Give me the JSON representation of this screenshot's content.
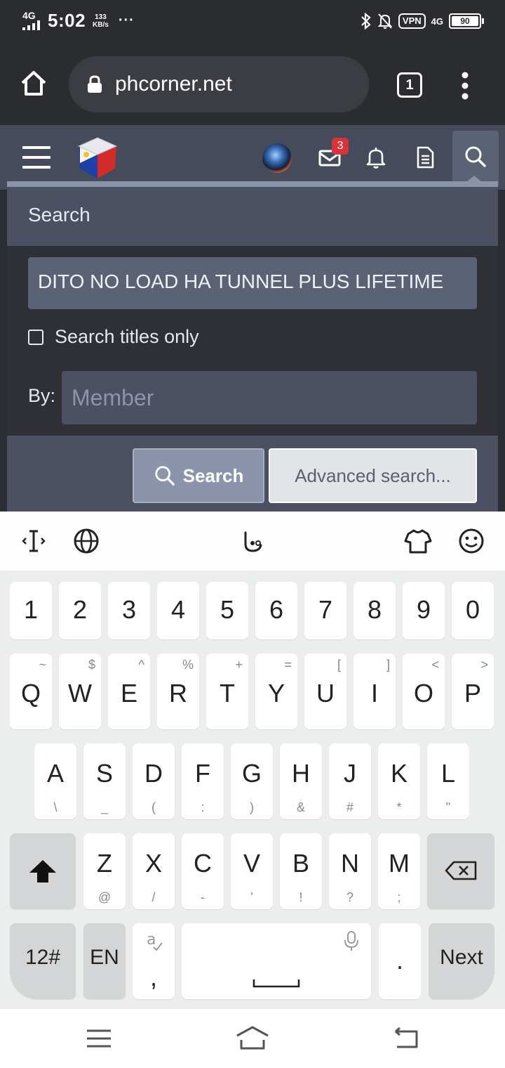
{
  "status_bar": {
    "network": "4G",
    "time": "5:02",
    "speed_value": "133",
    "speed_unit": "KB/s",
    "more": "···",
    "vpn": "VPN",
    "net_right": "4G",
    "battery": "90"
  },
  "browser": {
    "url": "phcorner.net",
    "tab_count": "1"
  },
  "site_header": {
    "inbox_badge": "3"
  },
  "search_panel": {
    "title": "Search",
    "query": "DITO NO LOAD HA TUNNEL PLUS LIFETIME",
    "titles_only_label": "Search titles only",
    "by_label": "By:",
    "member_placeholder": "Member",
    "search_button": "Search",
    "advanced_button": "Advanced search..."
  },
  "keyboard": {
    "number_row": [
      "1",
      "2",
      "3",
      "4",
      "5",
      "6",
      "7",
      "8",
      "9",
      "0"
    ],
    "row1": [
      {
        "k": "Q",
        "s": "~"
      },
      {
        "k": "W",
        "s": "$"
      },
      {
        "k": "E",
        "s": "^"
      },
      {
        "k": "R",
        "s": "%"
      },
      {
        "k": "T",
        "s": "+"
      },
      {
        "k": "Y",
        "s": "="
      },
      {
        "k": "U",
        "s": "["
      },
      {
        "k": "I",
        "s": "]"
      },
      {
        "k": "O",
        "s": "<"
      },
      {
        "k": "P",
        "s": ">"
      }
    ],
    "row2": [
      {
        "k": "A",
        "s": "\\"
      },
      {
        "k": "S",
        "s": "_"
      },
      {
        "k": "D",
        "s": "("
      },
      {
        "k": "F",
        "s": ":"
      },
      {
        "k": "G",
        "s": ")"
      },
      {
        "k": "H",
        "s": "&"
      },
      {
        "k": "J",
        "s": "#"
      },
      {
        "k": "K",
        "s": "*"
      },
      {
        "k": "L",
        "s": "\""
      }
    ],
    "row3": [
      {
        "k": "Z",
        "s": "@"
      },
      {
        "k": "X",
        "s": "/"
      },
      {
        "k": "C",
        "s": "-"
      },
      {
        "k": "V",
        "s": "'"
      },
      {
        "k": "B",
        "s": "!"
      },
      {
        "k": "N",
        "s": "?"
      },
      {
        "k": "M",
        "s": ";"
      }
    ],
    "symbols_key": "12#",
    "lang_key": "EN",
    "comma_key": ",",
    "period_key": ".",
    "next_key": "Next"
  }
}
